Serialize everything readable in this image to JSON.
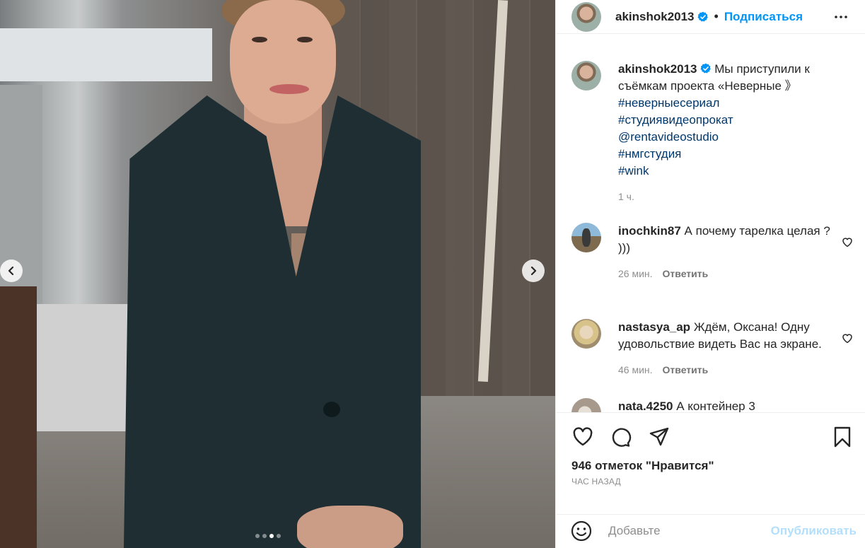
{
  "post": {
    "author": "akinshok2013",
    "follow_label": "Подписаться",
    "separator": "•",
    "caption": {
      "text": "Мы приступили к съёмкам проекта «Неверные 》",
      "tags": [
        "#неверныесериал",
        "#студиявидеопрокат",
        "@rentavideostudio",
        "#нмгстудия",
        "#wink"
      ],
      "time": "1 ч."
    },
    "carousel": {
      "count": 4,
      "active_index": 2
    }
  },
  "comments": [
    {
      "user": "inochkin87",
      "text": "А почему тарелка целая ? )))",
      "time": "26 мин.",
      "reply_label": "Ответить"
    },
    {
      "user": "nastasya_ap",
      "text": "Ждём, Оксана! Одну удовольствие видеть Вас на экране.",
      "time": "46 мин.",
      "reply_label": "Ответить"
    },
    {
      "user": "nata.4250",
      "text": "А контейнер 3"
    }
  ],
  "stats": {
    "likes": "946 отметок \"Нравится\"",
    "posted": "ЧАС НАЗАД"
  },
  "composer": {
    "placeholder": "Добавьте",
    "publish_label": "Опубликовать"
  },
  "icons": [
    "more-options-icon",
    "verified-badge-icon",
    "prev-arrow-icon",
    "next-arrow-icon",
    "like-heart-icon",
    "comment-icon",
    "share-icon",
    "save-bookmark-icon",
    "emoji-icon",
    "comment-like-icon"
  ],
  "colors": {
    "link": "#0095f6",
    "hashtag": "#00376b",
    "muted": "#8e8e8e",
    "publish_disabled": "#b2dffc"
  }
}
